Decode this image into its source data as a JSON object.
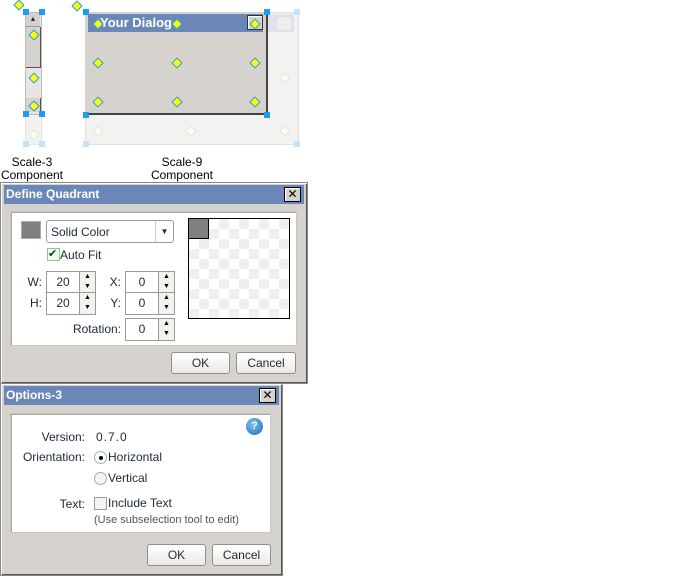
{
  "preview": {
    "dialog_title": "Your Dialog",
    "scale3_label_line1": "Scale-3",
    "scale3_label_line2": "Component",
    "scale9_label_line1": "Scale-9",
    "scale9_label_line2": "Component"
  },
  "define_quadrant": {
    "title": "Define Quadrant",
    "close": "✕",
    "fill_type": "Solid Color",
    "auto_fit_label": "Auto Fit",
    "auto_fit_checked": true,
    "w_label": "W:",
    "w_value": "20",
    "h_label": "H:",
    "h_value": "20",
    "x_label": "X:",
    "x_value": "0",
    "y_label": "Y:",
    "y_value": "0",
    "rotation_label": "Rotation:",
    "rotation_value": "0",
    "swatch_color": "#808080",
    "ok": "OK",
    "cancel": "Cancel"
  },
  "options3": {
    "title": "Options-3",
    "close": "✕",
    "help": "?",
    "version_label": "Version:",
    "version_value": "0.7.0",
    "orientation_label": "Orientation:",
    "orientation_options": [
      "Horizontal",
      "Vertical"
    ],
    "orientation_selected": "Horizontal",
    "text_label": "Text:",
    "include_text_label": "Include Text",
    "include_text_checked": false,
    "hint": "(Use subselection tool to edit)",
    "ok": "OK",
    "cancel": "Cancel"
  }
}
